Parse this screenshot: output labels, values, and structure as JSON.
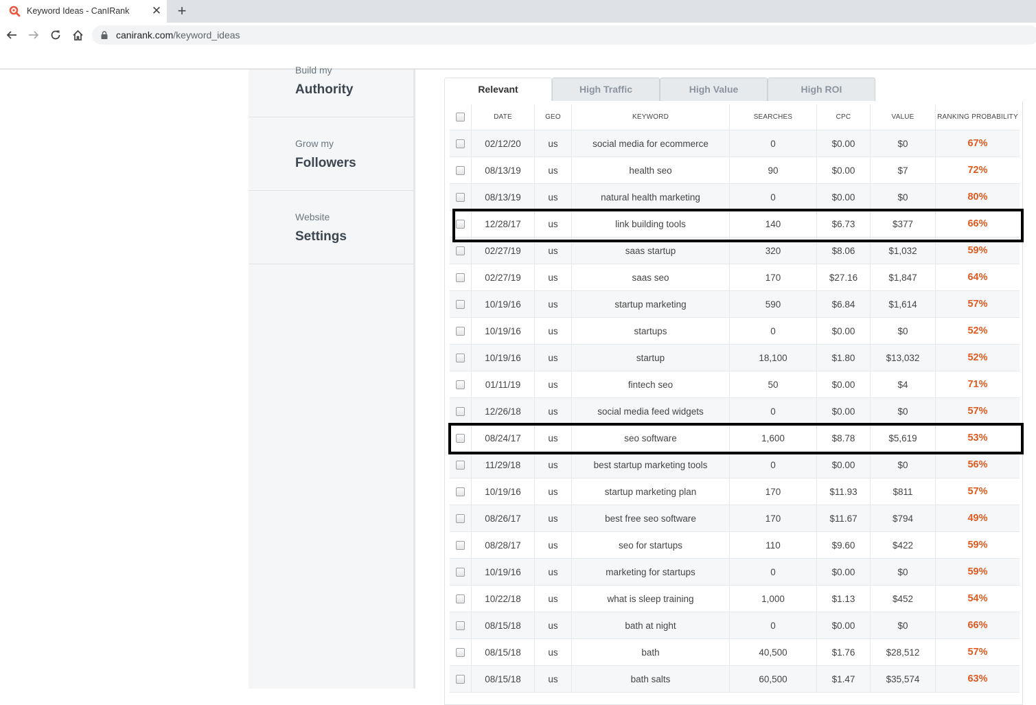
{
  "browser": {
    "tab_title": "Keyword Ideas - CanIRank",
    "tab_close": "✕",
    "new_tab": "+",
    "url_domain": "canirank.com",
    "url_path": "/keyword_ideas"
  },
  "sidebar": {
    "items": [
      {
        "sub": "Build my",
        "main": "Authority"
      },
      {
        "sub": "Grow my",
        "main": "Followers"
      },
      {
        "sub": "Website",
        "main": "Settings"
      }
    ]
  },
  "tabs": [
    "Relevant",
    "High Traffic",
    "High Value",
    "High ROI"
  ],
  "active_tab": "Relevant",
  "table": {
    "headers": [
      "DATE",
      "GEO",
      "KEYWORD",
      "SEARCHES",
      "CPC",
      "VALUE",
      "RANKING PROBABILITY"
    ],
    "rows": [
      {
        "date": "02/12/20",
        "geo": "us",
        "keyword": "social media for ecommerce",
        "searches": "0",
        "cpc": "$0.00",
        "value": "$0",
        "prob": "67%"
      },
      {
        "date": "08/13/19",
        "geo": "us",
        "keyword": "health seo",
        "searches": "90",
        "cpc": "$0.00",
        "value": "$7",
        "prob": "72%"
      },
      {
        "date": "08/13/19",
        "geo": "us",
        "keyword": "natural health marketing",
        "searches": "0",
        "cpc": "$0.00",
        "value": "$0",
        "prob": "80%"
      },
      {
        "date": "12/28/17",
        "geo": "us",
        "keyword": "link building tools",
        "searches": "140",
        "cpc": "$6.73",
        "value": "$377",
        "prob": "66%"
      },
      {
        "date": "02/27/19",
        "geo": "us",
        "keyword": "saas startup",
        "searches": "320",
        "cpc": "$8.06",
        "value": "$1,032",
        "prob": "59%"
      },
      {
        "date": "02/27/19",
        "geo": "us",
        "keyword": "saas seo",
        "searches": "170",
        "cpc": "$27.16",
        "value": "$1,847",
        "prob": "64%"
      },
      {
        "date": "10/19/16",
        "geo": "us",
        "keyword": "startup marketing",
        "searches": "590",
        "cpc": "$6.84",
        "value": "$1,614",
        "prob": "57%"
      },
      {
        "date": "10/19/16",
        "geo": "us",
        "keyword": "startups",
        "searches": "0",
        "cpc": "$0.00",
        "value": "$0",
        "prob": "52%"
      },
      {
        "date": "10/19/16",
        "geo": "us",
        "keyword": "startup",
        "searches": "18,100",
        "cpc": "$1.80",
        "value": "$13,032",
        "prob": "52%"
      },
      {
        "date": "01/11/19",
        "geo": "us",
        "keyword": "fintech seo",
        "searches": "50",
        "cpc": "$0.00",
        "value": "$4",
        "prob": "71%"
      },
      {
        "date": "12/26/18",
        "geo": "us",
        "keyword": "social media feed widgets",
        "searches": "0",
        "cpc": "$0.00",
        "value": "$0",
        "prob": "57%"
      },
      {
        "date": "08/24/17",
        "geo": "us",
        "keyword": "seo software",
        "searches": "1,600",
        "cpc": "$8.78",
        "value": "$5,619",
        "prob": "53%"
      },
      {
        "date": "11/29/18",
        "geo": "us",
        "keyword": "best startup marketing tools",
        "searches": "0",
        "cpc": "$0.00",
        "value": "$0",
        "prob": "56%"
      },
      {
        "date": "10/19/16",
        "geo": "us",
        "keyword": "startup marketing plan",
        "searches": "170",
        "cpc": "$11.93",
        "value": "$811",
        "prob": "57%"
      },
      {
        "date": "08/26/17",
        "geo": "us",
        "keyword": "best free seo software",
        "searches": "170",
        "cpc": "$11.67",
        "value": "$794",
        "prob": "49%"
      },
      {
        "date": "08/28/17",
        "geo": "us",
        "keyword": "seo for startups",
        "searches": "110",
        "cpc": "$9.60",
        "value": "$422",
        "prob": "59%"
      },
      {
        "date": "10/19/16",
        "geo": "us",
        "keyword": "marketing for startups",
        "searches": "0",
        "cpc": "$0.00",
        "value": "$0",
        "prob": "59%"
      },
      {
        "date": "10/22/18",
        "geo": "us",
        "keyword": "what is sleep training",
        "searches": "1,000",
        "cpc": "$1.13",
        "value": "$452",
        "prob": "54%"
      },
      {
        "date": "08/15/18",
        "geo": "us",
        "keyword": "bath at night",
        "searches": "0",
        "cpc": "$0.00",
        "value": "$0",
        "prob": "66%"
      },
      {
        "date": "08/15/18",
        "geo": "us",
        "keyword": "bath",
        "searches": "40,500",
        "cpc": "$1.76",
        "value": "$28,512",
        "prob": "57%"
      },
      {
        "date": "08/15/18",
        "geo": "us",
        "keyword": "bath salts",
        "searches": "60,500",
        "cpc": "$1.47",
        "value": "$35,574",
        "prob": "63%"
      }
    ],
    "highlighted_keywords": [
      "link building tools",
      "seo software"
    ]
  },
  "colors": {
    "probability": "#e05a1f",
    "highlight_border": "#000000",
    "favicon": "#e8573f"
  }
}
